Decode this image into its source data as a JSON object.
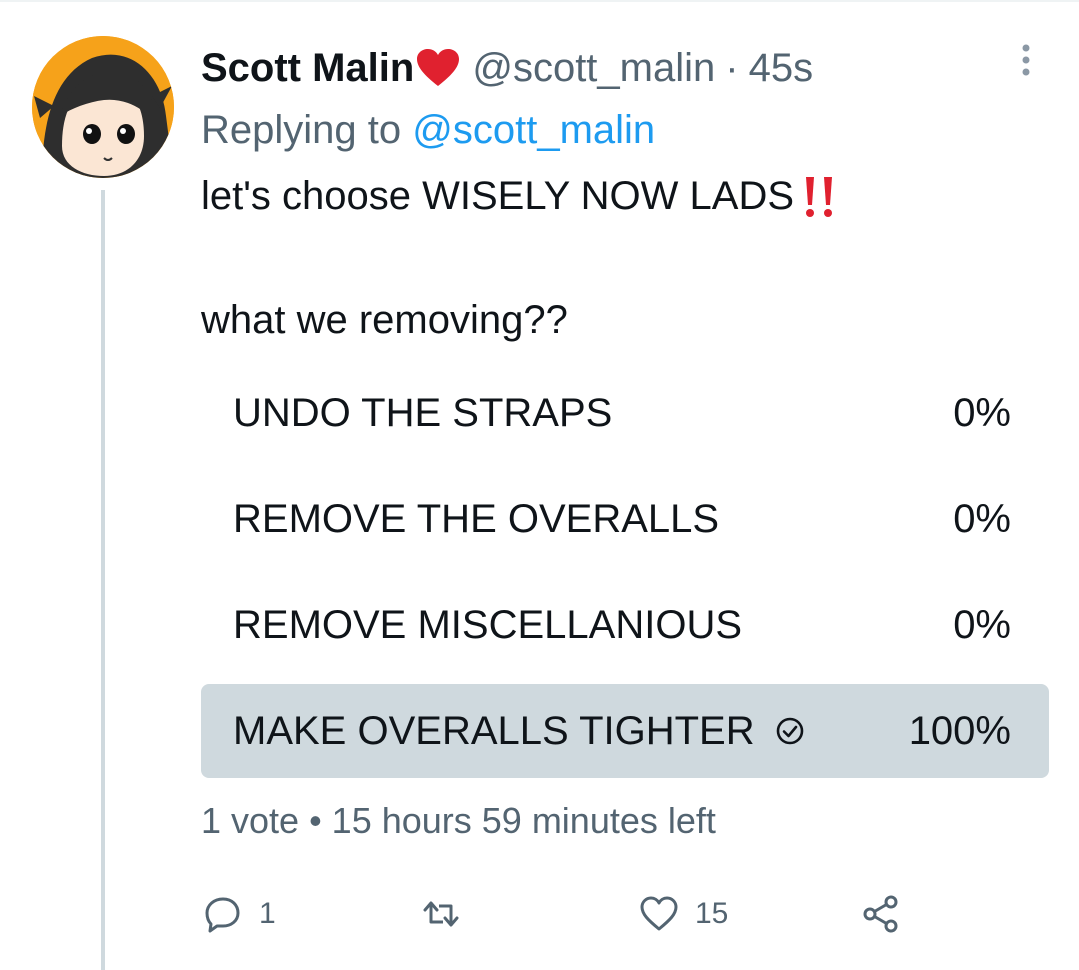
{
  "tweet": {
    "author": {
      "name": "Scott Malin",
      "handle": "@scott_malin",
      "separator": "·",
      "time": "45s",
      "badge_emoji": "heart-emoji"
    },
    "reply_prefix": "Replying to",
    "reply_handle": "@scott_malin",
    "text_line1": "let's choose WISELY NOW LADS",
    "text_emoji": "double-exclamation-emoji",
    "text_line2": "what we removing??",
    "poll": {
      "options": [
        {
          "label": "UNDO THE STRAPS",
          "percent": "0%",
          "value": 0
        },
        {
          "label": "REMOVE THE OVERALLS",
          "percent": "0%",
          "value": 0
        },
        {
          "label": "REMOVE MISCELLANIOUS",
          "percent": "0%",
          "value": 0
        },
        {
          "label": "MAKE OVERALLS TIGHTER",
          "percent": "100%",
          "value": 100,
          "selected": true
        }
      ],
      "meta": "1 vote • 15 hours 59 minutes left"
    },
    "actions": {
      "reply_count": "1",
      "retweet_count": "",
      "like_count": "15"
    }
  },
  "colors": {
    "text_primary": "#0f1419",
    "text_secondary": "#536471",
    "link": "#1d9bf0",
    "poll_fill": "#cfd9de",
    "emoji_red": "#e0212f",
    "avatar_bg": "#f6a21a"
  }
}
